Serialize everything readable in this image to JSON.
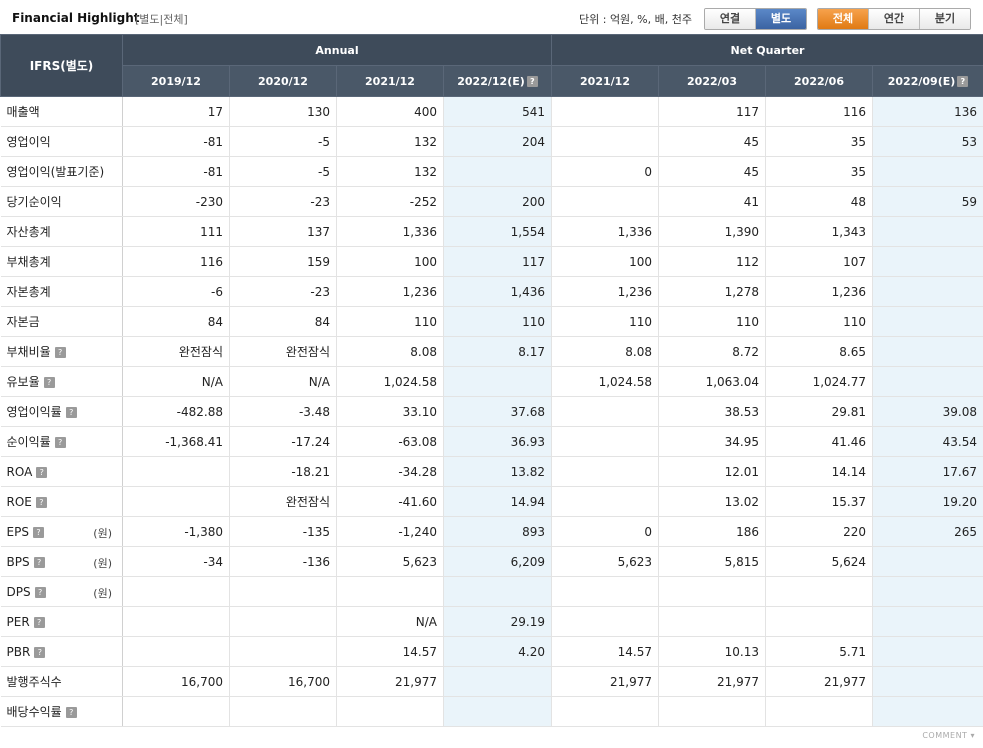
{
  "header": {
    "title": "Financial Highlight",
    "subtitle": "[별도|전체]",
    "unit": "단위 : 억원, %, 배, 천주",
    "toggle1": [
      "연결",
      "별도"
    ],
    "toggle2": [
      "전체",
      "연간",
      "분기"
    ],
    "toggle1_selected": 1,
    "toggle2_selected": 0
  },
  "table": {
    "corner": "IFRS(별도)",
    "group_annual": "Annual",
    "group_quarter": "Net Quarter",
    "columns": [
      "2019/12",
      "2020/12",
      "2021/12",
      "2022/12(E)",
      "2021/12",
      "2022/03",
      "2022/06",
      "2022/09(E)"
    ],
    "rows": [
      {
        "label": "매출액",
        "help": false,
        "won": "",
        "values": [
          "17",
          "130",
          "400",
          "541",
          "",
          "117",
          "116",
          "136"
        ]
      },
      {
        "label": "영업이익",
        "help": false,
        "won": "",
        "values": [
          "-81",
          "-5",
          "132",
          "204",
          "",
          "45",
          "35",
          "53"
        ]
      },
      {
        "label": "영업이익(발표기준)",
        "help": false,
        "won": "",
        "values": [
          "-81",
          "-5",
          "132",
          "",
          "0",
          "45",
          "35",
          ""
        ]
      },
      {
        "label": "당기순이익",
        "help": false,
        "won": "",
        "values": [
          "-230",
          "-23",
          "-252",
          "200",
          "",
          "41",
          "48",
          "59"
        ]
      },
      {
        "label": "자산총계",
        "help": false,
        "won": "",
        "values": [
          "111",
          "137",
          "1,336",
          "1,554",
          "1,336",
          "1,390",
          "1,343",
          ""
        ]
      },
      {
        "label": "부채총계",
        "help": false,
        "won": "",
        "values": [
          "116",
          "159",
          "100",
          "117",
          "100",
          "112",
          "107",
          ""
        ]
      },
      {
        "label": "자본총계",
        "help": false,
        "won": "",
        "values": [
          "-6",
          "-23",
          "1,236",
          "1,436",
          "1,236",
          "1,278",
          "1,236",
          ""
        ]
      },
      {
        "label": "자본금",
        "help": false,
        "won": "",
        "values": [
          "84",
          "84",
          "110",
          "110",
          "110",
          "110",
          "110",
          ""
        ]
      },
      {
        "label": "부채비율",
        "help": true,
        "won": "",
        "values": [
          "완전잠식",
          "완전잠식",
          "8.08",
          "8.17",
          "8.08",
          "8.72",
          "8.65",
          ""
        ]
      },
      {
        "label": "유보율",
        "help": true,
        "won": "",
        "values": [
          "N/A",
          "N/A",
          "1,024.58",
          "",
          "1,024.58",
          "1,063.04",
          "1,024.77",
          ""
        ]
      },
      {
        "label": "영업이익률",
        "help": true,
        "won": "",
        "values": [
          "-482.88",
          "-3.48",
          "33.10",
          "37.68",
          "",
          "38.53",
          "29.81",
          "39.08"
        ]
      },
      {
        "label": "순이익률",
        "help": true,
        "won": "",
        "values": [
          "-1,368.41",
          "-17.24",
          "-63.08",
          "36.93",
          "",
          "34.95",
          "41.46",
          "43.54"
        ]
      },
      {
        "label": "ROA",
        "help": true,
        "won": "",
        "values": [
          "",
          "-18.21",
          "-34.28",
          "13.82",
          "",
          "12.01",
          "14.14",
          "17.67"
        ]
      },
      {
        "label": "ROE",
        "help": true,
        "won": "",
        "values": [
          "",
          "완전잠식",
          "-41.60",
          "14.94",
          "",
          "13.02",
          "15.37",
          "19.20"
        ]
      },
      {
        "label": "EPS",
        "help": true,
        "won": "(원)",
        "values": [
          "-1,380",
          "-135",
          "-1,240",
          "893",
          "0",
          "186",
          "220",
          "265"
        ]
      },
      {
        "label": "BPS",
        "help": true,
        "won": "(원)",
        "values": [
          "-34",
          "-136",
          "5,623",
          "6,209",
          "5,623",
          "5,815",
          "5,624",
          ""
        ]
      },
      {
        "label": "DPS",
        "help": true,
        "won": "(원)",
        "values": [
          "",
          "",
          "",
          "",
          "",
          "",
          "",
          ""
        ]
      },
      {
        "label": "PER",
        "help": true,
        "won": "",
        "values": [
          "",
          "",
          "N/A",
          "29.19",
          "",
          "",
          "",
          ""
        ]
      },
      {
        "label": "PBR",
        "help": true,
        "won": "",
        "values": [
          "",
          "",
          "14.57",
          "4.20",
          "14.57",
          "10.13",
          "5.71",
          ""
        ]
      },
      {
        "label": "발행주식수",
        "help": false,
        "won": "",
        "values": [
          "16,700",
          "16,700",
          "21,977",
          "",
          "21,977",
          "21,977",
          "21,977",
          ""
        ]
      },
      {
        "label": "배당수익률",
        "help": true,
        "won": "",
        "values": [
          "",
          "",
          "",
          "",
          "",
          "",
          "",
          ""
        ]
      }
    ]
  },
  "footer": {
    "comment": "COMMENT ▾"
  },
  "colors": {
    "header_bg": "#3e4b5a",
    "estimate_bg": "#eaf4fa",
    "negative": "#c0392b",
    "tab_on_blue": "#3b63a2",
    "tab_on_orange": "#e07a14"
  }
}
